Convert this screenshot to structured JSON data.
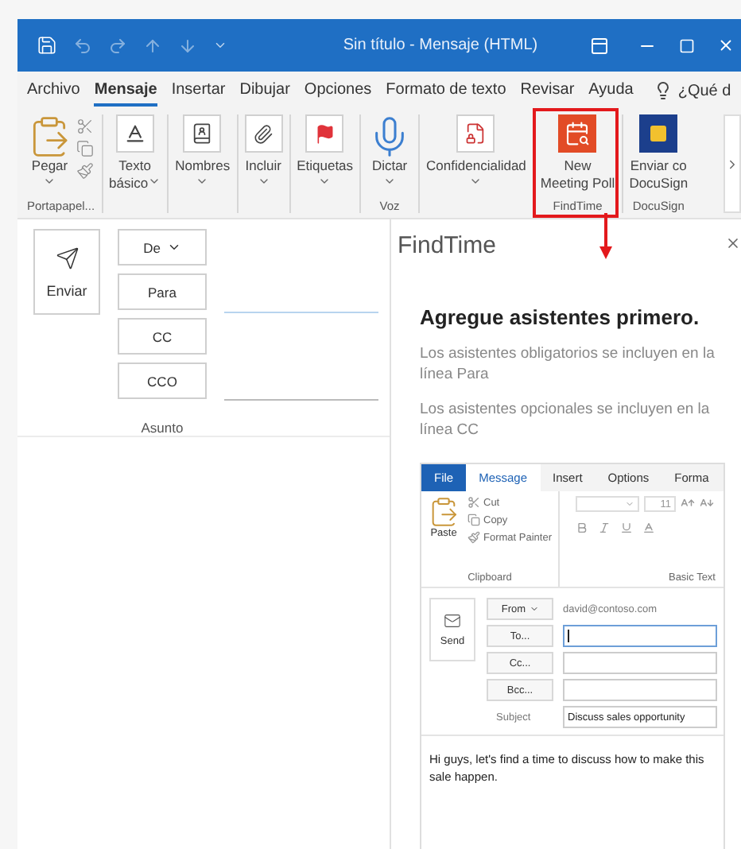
{
  "title_bar": {
    "title": "Sin título  -  Mensaje (HTML)"
  },
  "menu_tabs": [
    {
      "label": "Archivo",
      "selected": false
    },
    {
      "label": "Mensaje",
      "selected": true
    },
    {
      "label": "Insertar",
      "selected": false
    },
    {
      "label": "Dibujar",
      "selected": false
    },
    {
      "label": "Opciones",
      "selected": false
    },
    {
      "label": "Formato de texto",
      "selected": false
    },
    {
      "label": "Revisar",
      "selected": false
    },
    {
      "label": "Ayuda",
      "selected": false
    }
  ],
  "tell_me": "¿Qué d",
  "ribbon": [
    {
      "label": "Portapapel...",
      "highlighted": false,
      "buttons": [
        {
          "lines": [
            "Pegar"
          ],
          "dropdown": true
        }
      ]
    },
    {
      "highlighted": false,
      "buttons": [
        {
          "lines": [
            "Texto",
            "básico"
          ],
          "dropdown": true
        }
      ]
    },
    {
      "highlighted": false,
      "buttons": [
        {
          "lines": [
            "Nombres"
          ],
          "dropdown": true
        }
      ]
    },
    {
      "highlighted": false,
      "buttons": [
        {
          "lines": [
            "Incluir"
          ],
          "dropdown": true
        }
      ]
    },
    {
      "highlighted": false,
      "buttons": [
        {
          "lines": [
            "Etiquetas"
          ],
          "dropdown": true
        }
      ]
    },
    {
      "label": "Voz",
      "highlighted": false,
      "buttons": [
        {
          "lines": [
            "Dictar"
          ],
          "dropdown": true
        }
      ]
    },
    {
      "highlighted": false,
      "buttons": [
        {
          "lines": [
            "Confidencialidad"
          ],
          "dropdown": true
        }
      ]
    },
    {
      "label": "FindTime",
      "highlighted": true,
      "buttons": [
        {
          "lines": [
            "New",
            "Meeting Poll"
          ],
          "dropdown": false
        }
      ]
    },
    {
      "label": "DocuSign",
      "highlighted": false,
      "buttons": [
        {
          "lines": [
            "Enviar co",
            "DocuSign"
          ],
          "dropdown": false
        }
      ]
    }
  ],
  "compose": {
    "send": "Enviar",
    "fields": [
      {
        "label": "De",
        "dropdown": true
      },
      {
        "label": "Para",
        "dropdown": false
      },
      {
        "label": "CC",
        "dropdown": false
      },
      {
        "label": "CCO",
        "dropdown": false
      }
    ],
    "subject_label": "Asunto"
  },
  "findtime": {
    "title": "FindTime",
    "heading": "Agregue asistentes primero.",
    "paragraphs": [
      "Los asistentes obligatorios se incluyen en la línea Para",
      "Los asistentes opcionales se incluyen en la línea CC"
    ]
  },
  "example": {
    "tabs": [
      {
        "label": "File",
        "kind": "file",
        "selected": false
      },
      {
        "label": "Message",
        "kind": "tab",
        "selected": true
      },
      {
        "label": "Insert",
        "kind": "tab",
        "selected": false
      },
      {
        "label": "Options",
        "kind": "tab",
        "selected": false
      },
      {
        "label": "Forma",
        "kind": "tab",
        "selected": false
      }
    ],
    "clipboard": {
      "paste": "Paste",
      "items": [
        "Cut",
        "Copy",
        "Format Painter"
      ],
      "label": "Clipboard"
    },
    "basic_text": {
      "size": "11",
      "label": "Basic Text"
    },
    "send": "Send",
    "from": "From",
    "from_value": "david@contoso.com",
    "recipients": [
      {
        "label": "To...",
        "focused": true
      },
      {
        "label": "Cc...",
        "focused": false
      },
      {
        "label": "Bcc...",
        "focused": false
      }
    ],
    "subject_label": "Subject",
    "subject_value": "Discuss sales opportunity",
    "body": "Hi guys, let's find a time to discuss how to make this sale happen."
  }
}
